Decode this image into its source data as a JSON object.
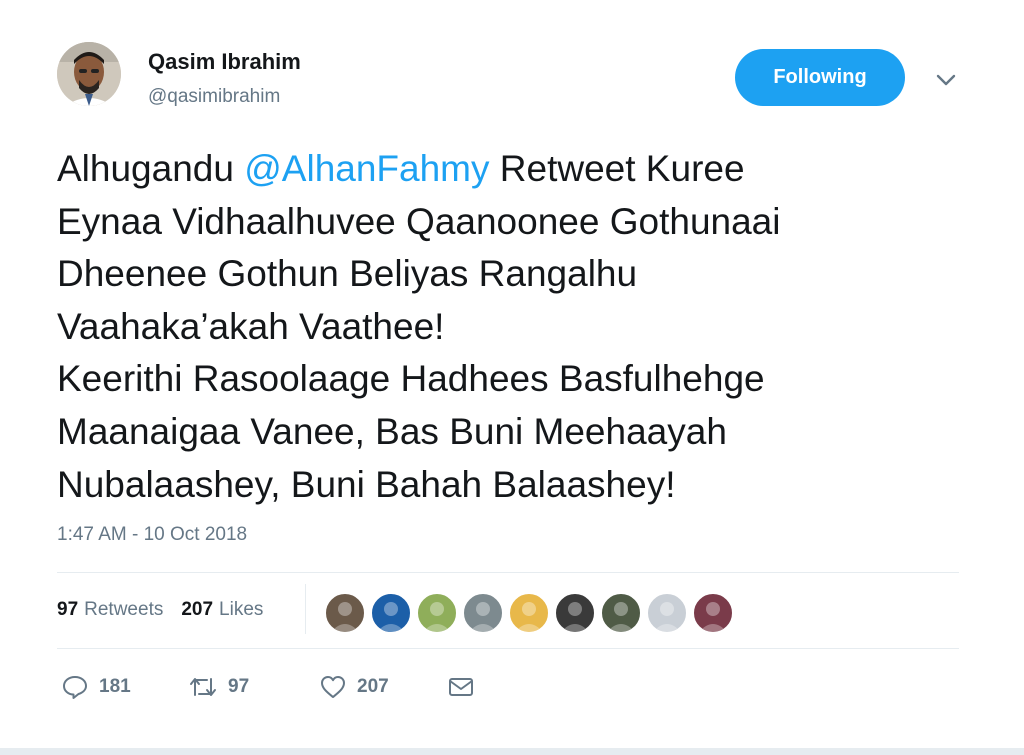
{
  "author": {
    "display_name": "Qasim Ibrahim",
    "handle": "@qasimibrahim"
  },
  "follow_button_label": "Following",
  "tweet": {
    "lines": [
      {
        "before": "Alhugandu ",
        "mention": "@AlhanFahmy",
        "after": " Retweet Kuree"
      },
      {
        "text": "Eynaa Vidhaalhuvee Qaanoonee Gothunaai"
      },
      {
        "text": "Dheenee Gothun Beliyas Rangalhu"
      },
      {
        "text": "Vaahaka’akah Vaathee!"
      },
      {
        "text": "Keerithi Rasoolaage Hadhees Basfulhehge"
      },
      {
        "text": "Maanaigaa Vanee, Bas Buni Meehaayah"
      },
      {
        "text": "Nubalaashey, Buni Bahah Balaashey!"
      }
    ],
    "timestamp": "1:47 AM - 10 Oct 2018"
  },
  "stats": {
    "retweets_count": "97",
    "retweets_label": "Retweets",
    "likes_count": "207",
    "likes_label": "Likes"
  },
  "liker_avatar_colors": [
    "#6b5a4a",
    "#1c5fa8",
    "#8fae5a",
    "#7d8a8f",
    "#e8b84a",
    "#3a3a3a",
    "#4f5b46",
    "#c9cfd6",
    "#7a3b4a"
  ],
  "actions": {
    "reply_count": "181",
    "retweet_count": "97",
    "like_count": "207"
  },
  "colors": {
    "accent": "#1da1f2",
    "text_primary": "#14171a",
    "text_secondary": "#657786"
  }
}
